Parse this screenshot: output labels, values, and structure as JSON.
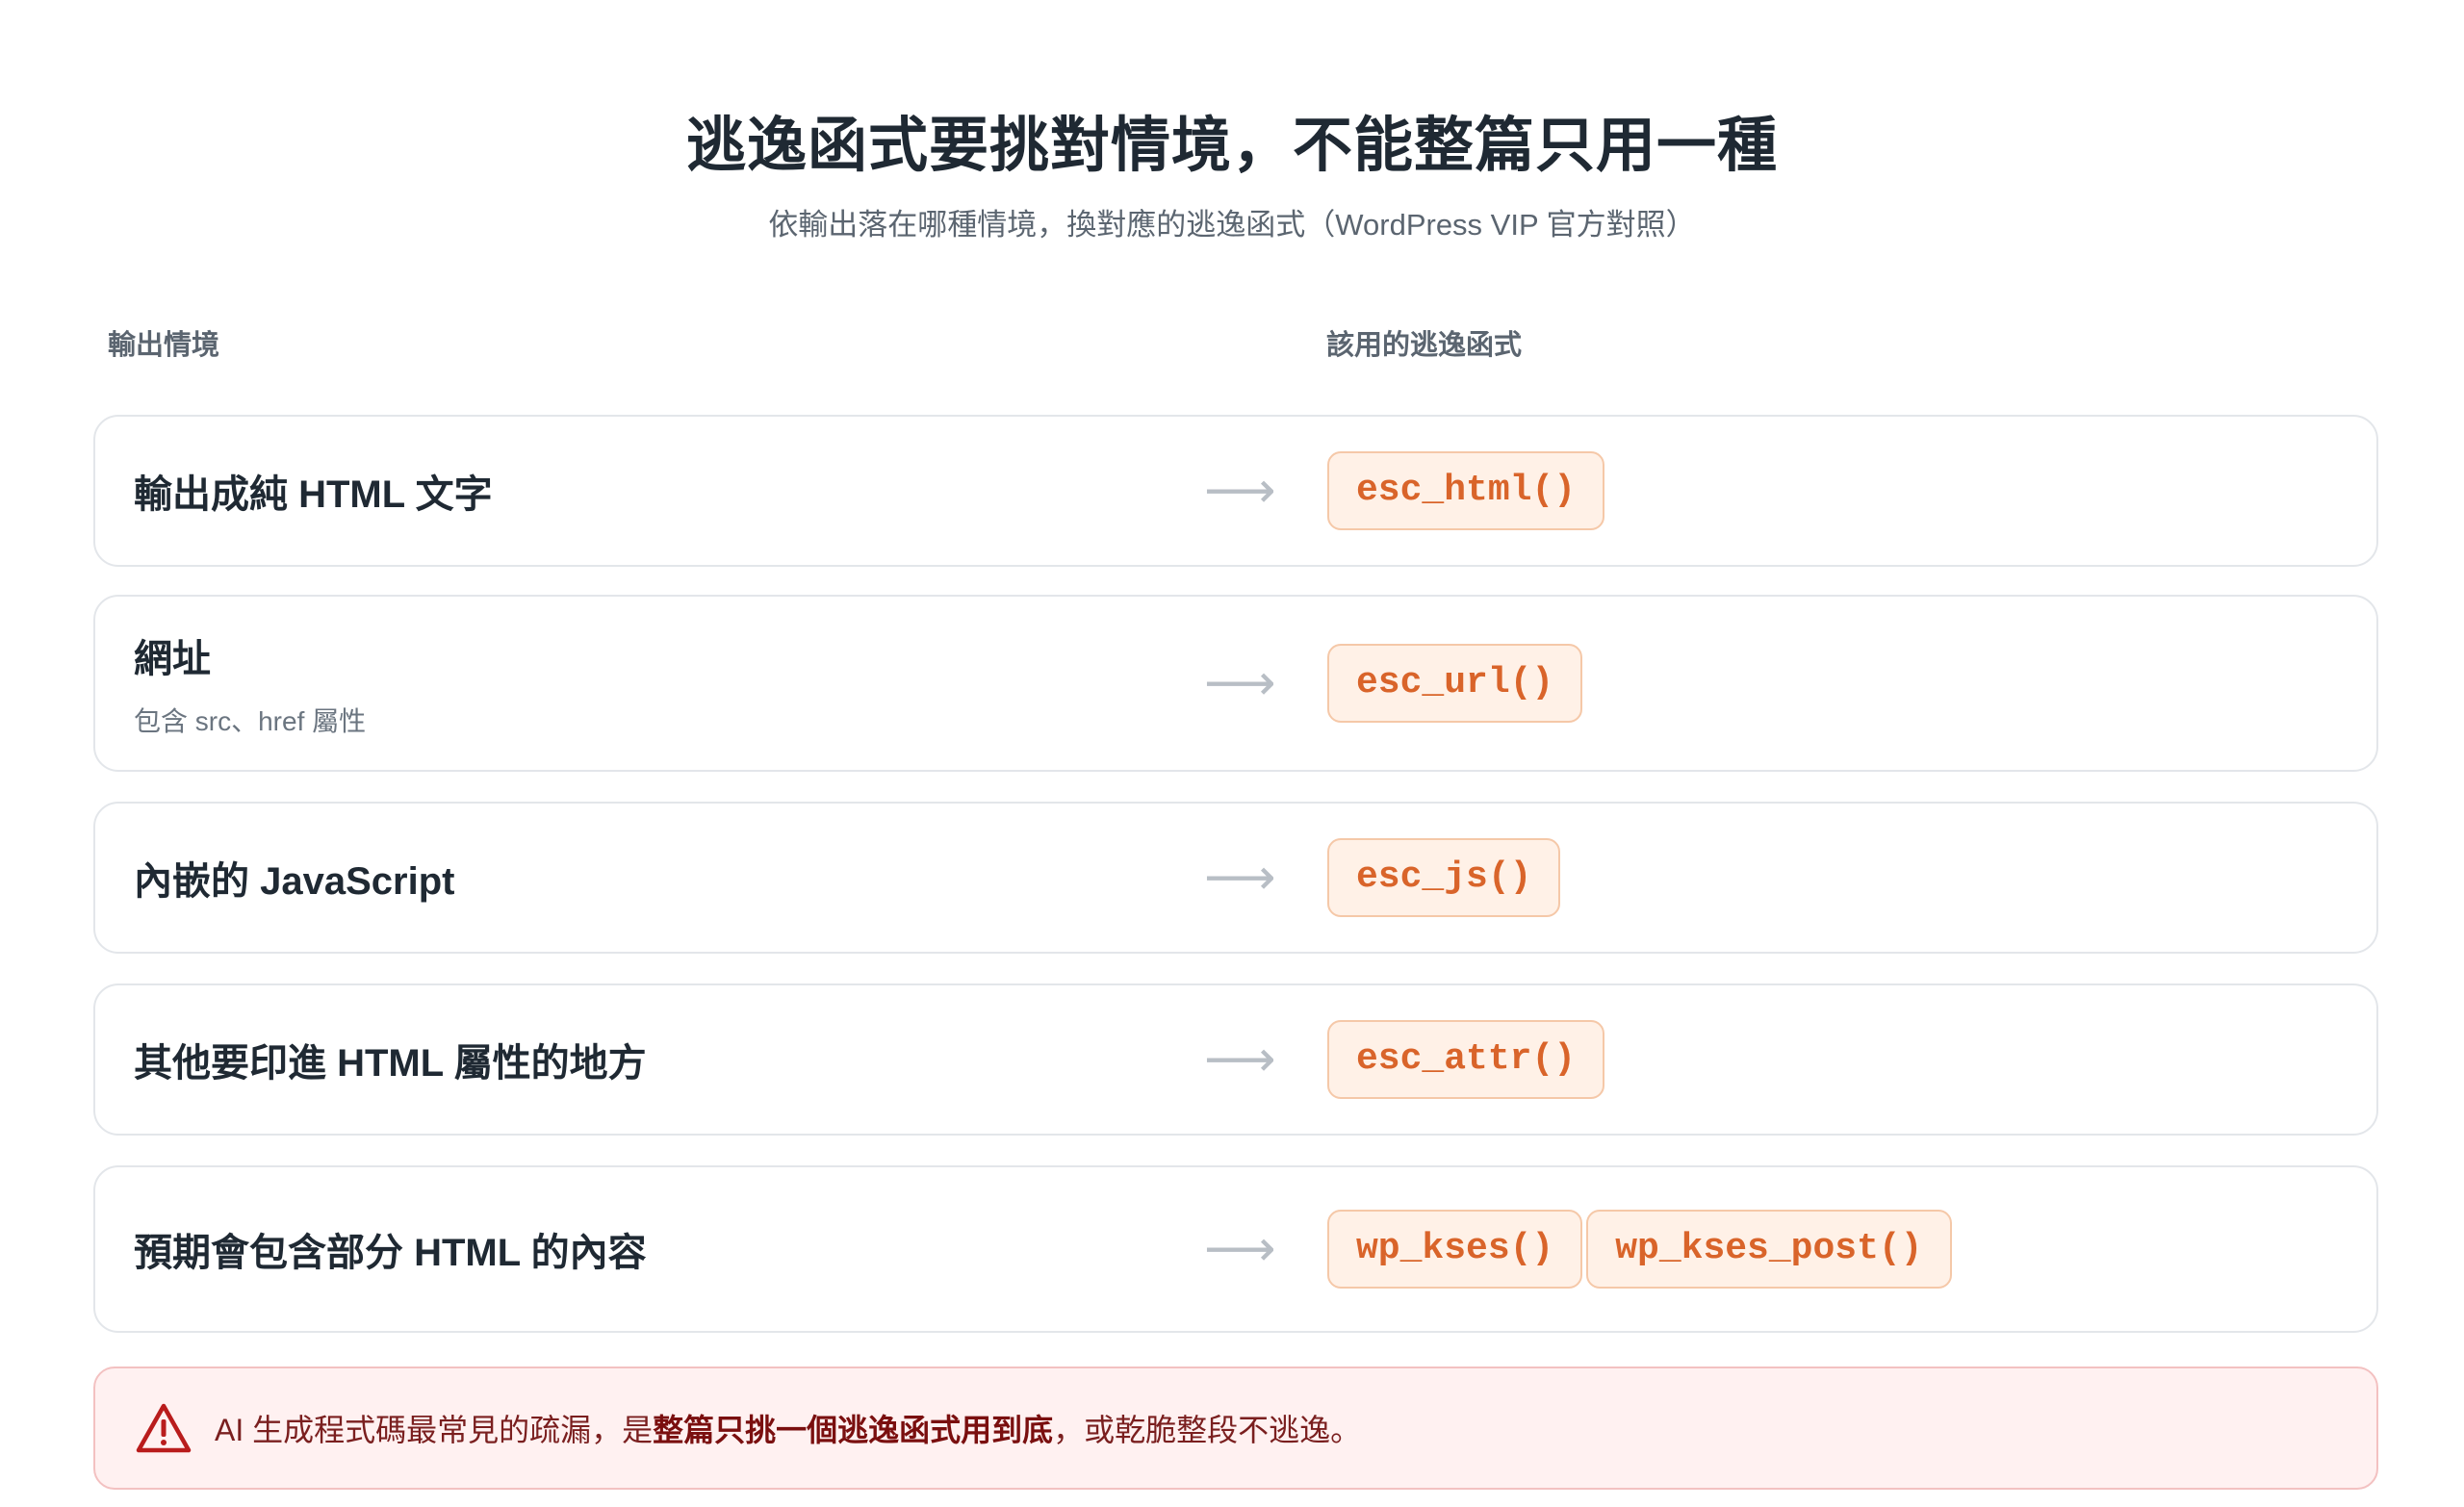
{
  "header": {
    "title": "逃逸函式要挑對情境，不能整篇只用一種",
    "subtitle": "依輸出落在哪種情境，換對應的逃逸函式（WordPress VIP 官方對照）"
  },
  "columns": {
    "context": "輸出情境",
    "function": "該用的逃逸函式"
  },
  "arrow_glyph": "⟶",
  "rows": [
    {
      "label": "輸出成純 HTML 文字",
      "note": "",
      "funcs": [
        "esc_html()"
      ]
    },
    {
      "label": "網址",
      "note": "包含 src、href 屬性",
      "funcs": [
        "esc_url()"
      ]
    },
    {
      "label": "內嵌的 JavaScript",
      "note": "",
      "funcs": [
        "esc_js()"
      ]
    },
    {
      "label": "其他要印進 HTML 屬性的地方",
      "note": "",
      "funcs": [
        "esc_attr()"
      ]
    },
    {
      "label": "預期會包含部分 HTML 的內容",
      "note": "",
      "funcs": [
        "wp_kses()",
        "wp_kses_post()"
      ]
    }
  ],
  "warning": {
    "icon": "warning-triangle-icon",
    "prefix": "AI 生成程式碼最常見的疏漏，是",
    "emphasis": "整篇只挑一個逃逸函式用到底",
    "suffix": "，或乾脆整段不逃逸。"
  },
  "colors": {
    "accent": "#d9642a",
    "chip_bg": "#fff1e7",
    "chip_border": "#f5c8a8",
    "warn_bg": "#fff1f1",
    "warn_border": "#f3c1c1",
    "warn_icon": "#b91c1c"
  }
}
